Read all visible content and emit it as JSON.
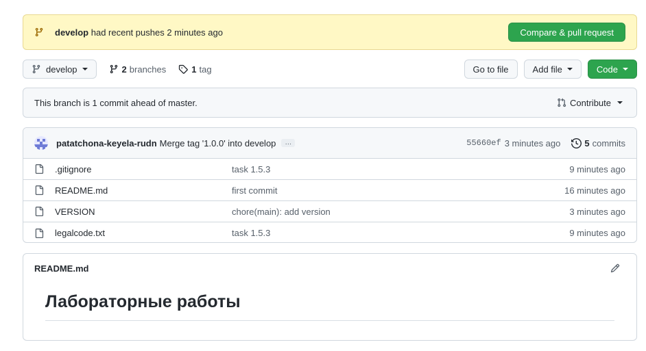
{
  "banner": {
    "branch": "develop",
    "message": " had recent pushes 2 minutes ago",
    "button_label": "Compare & pull request"
  },
  "toolbar": {
    "branch_selector": "develop",
    "branches_count": "2",
    "branches_label": "branches",
    "tags_count": "1",
    "tags_label": "tag",
    "go_to_file": "Go to file",
    "add_file": "Add file",
    "code": "Code"
  },
  "branch_info": {
    "text": "This branch is 1 commit ahead of master.",
    "contribute": "Contribute"
  },
  "latest_commit": {
    "author": "patatchona-keyela-rudn",
    "message": "Merge tag '1.0.0' into develop",
    "ellipsis": "…",
    "sha": "55660ef",
    "age": "3 minutes ago",
    "commits_count": "5",
    "commits_label": "commits"
  },
  "files": [
    {
      "name": ".gitignore",
      "message": "task 1.5.3",
      "age": "9 minutes ago"
    },
    {
      "name": "README.md",
      "message": "first commit",
      "age": "16 minutes ago"
    },
    {
      "name": "VERSION",
      "message": "chore(main): add version",
      "age": "3 minutes ago"
    },
    {
      "name": "legalcode.txt",
      "message": "task 1.5.3",
      "age": "9 minutes ago"
    }
  ],
  "readme": {
    "title": "README.md",
    "heading": "Лабораторные работы"
  },
  "icons": {
    "branch": "git-branch-icon",
    "tag": "tag-icon",
    "pull_request": "git-pull-request-icon",
    "history": "history-icon",
    "file": "file-icon",
    "edit": "pencil-icon"
  },
  "colors": {
    "accent_green": "#2da44e",
    "banner_bg": "#fff8c5",
    "border": "#d0d7de"
  }
}
